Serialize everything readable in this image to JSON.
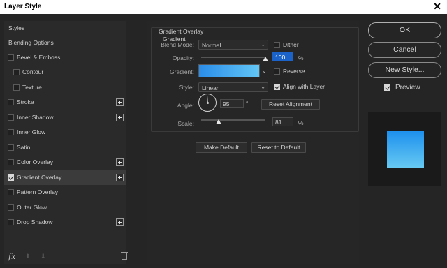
{
  "window": {
    "title": "Layer Style",
    "close_glyph": "✕"
  },
  "left_panel": {
    "items": [
      {
        "label": "Styles",
        "checkbox": false,
        "checked": false,
        "plus": false,
        "selected": false,
        "indent": false
      },
      {
        "label": "Blending Options",
        "checkbox": false,
        "checked": false,
        "plus": false,
        "selected": false,
        "indent": false
      },
      {
        "label": "Bevel & Emboss",
        "checkbox": true,
        "checked": false,
        "plus": false,
        "selected": false,
        "indent": false
      },
      {
        "label": "Contour",
        "checkbox": true,
        "checked": false,
        "plus": false,
        "selected": false,
        "indent": true
      },
      {
        "label": "Texture",
        "checkbox": true,
        "checked": false,
        "plus": false,
        "selected": false,
        "indent": true
      },
      {
        "label": "Stroke",
        "checkbox": true,
        "checked": false,
        "plus": true,
        "selected": false,
        "indent": false
      },
      {
        "label": "Inner Shadow",
        "checkbox": true,
        "checked": false,
        "plus": true,
        "selected": false,
        "indent": false
      },
      {
        "label": "Inner Glow",
        "checkbox": true,
        "checked": false,
        "plus": false,
        "selected": false,
        "indent": false
      },
      {
        "label": "Satin",
        "checkbox": true,
        "checked": false,
        "plus": false,
        "selected": false,
        "indent": false
      },
      {
        "label": "Color Overlay",
        "checkbox": true,
        "checked": false,
        "plus": true,
        "selected": false,
        "indent": false
      },
      {
        "label": "Gradient Overlay",
        "checkbox": true,
        "checked": true,
        "plus": true,
        "selected": true,
        "indent": false
      },
      {
        "label": "Pattern Overlay",
        "checkbox": true,
        "checked": false,
        "plus": false,
        "selected": false,
        "indent": false
      },
      {
        "label": "Outer Glow",
        "checkbox": true,
        "checked": false,
        "plus": false,
        "selected": false,
        "indent": false
      },
      {
        "label": "Drop Shadow",
        "checkbox": true,
        "checked": false,
        "plus": true,
        "selected": false,
        "indent": false
      }
    ],
    "footer": {
      "fx_label": "fx",
      "up_glyph": "⬆",
      "down_glyph": "⬇",
      "trash_icon": "trash-icon"
    }
  },
  "gradient_overlay": {
    "section_title": "Gradient Overlay",
    "group_title": "Gradient",
    "blend_mode": {
      "label": "Blend Mode:",
      "value": "Normal"
    },
    "dither": {
      "label": "Dither",
      "checked": false
    },
    "opacity": {
      "label": "Opacity:",
      "value": "100",
      "unit": "%",
      "level": 1.0
    },
    "gradient": {
      "label": "Gradient:",
      "start_color": "#2b8de8",
      "end_color": "#62c6f5"
    },
    "reverse": {
      "label": "Reverse",
      "checked": false
    },
    "style": {
      "label": "Style:",
      "value": "Linear"
    },
    "align_with_layer": {
      "label": "Align with Layer",
      "checked": true
    },
    "angle": {
      "label": "Angle:",
      "value": "95",
      "unit": "°"
    },
    "reset_alignment": "Reset Alignment",
    "scale": {
      "label": "Scale:",
      "value": "81",
      "unit": "%",
      "level": 0.27
    },
    "make_default": "Make Default",
    "reset_to_default": "Reset to Default"
  },
  "actions": {
    "ok": "OK",
    "cancel": "Cancel",
    "new_style": "New Style...",
    "preview_label": "Preview",
    "preview_checked": true
  },
  "colors": {
    "accent_highlight": "#1b63c8",
    "preview_top": "#1e90ee",
    "preview_bottom": "#66c9f2"
  },
  "chevron_glyph": "⌄"
}
